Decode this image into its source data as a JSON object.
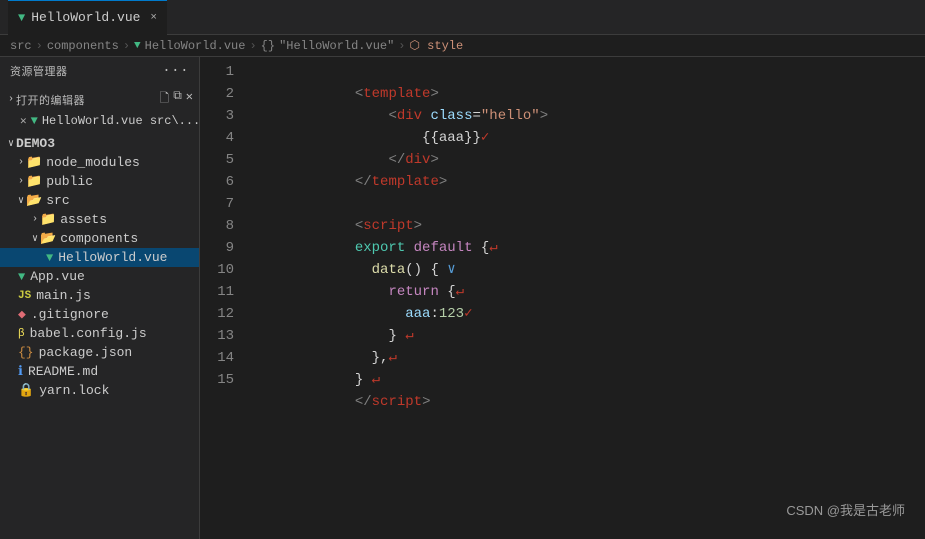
{
  "sidebar": {
    "header": "资源管理器",
    "icons": [
      "···"
    ],
    "open_editors_label": "打开的编辑器",
    "open_file": "HelloWorld.vue src\\...",
    "project_name": "DEMO3",
    "items": [
      {
        "id": "node_modules",
        "label": "node_modules",
        "type": "folder",
        "indent": 1,
        "collapsed": true
      },
      {
        "id": "public",
        "label": "public",
        "type": "folder",
        "indent": 1,
        "collapsed": true
      },
      {
        "id": "src",
        "label": "src",
        "type": "folder",
        "indent": 1,
        "collapsed": false
      },
      {
        "id": "assets",
        "label": "assets",
        "type": "folder",
        "indent": 2,
        "collapsed": true
      },
      {
        "id": "components",
        "label": "components",
        "type": "folder",
        "indent": 2,
        "collapsed": false
      },
      {
        "id": "HelloWorld.vue",
        "label": "HelloWorld.vue",
        "type": "vue",
        "indent": 3,
        "active": true
      },
      {
        "id": "App.vue",
        "label": "App.vue",
        "type": "vue",
        "indent": 1
      },
      {
        "id": "main.js",
        "label": "main.js",
        "type": "js",
        "indent": 1
      },
      {
        "id": ".gitignore",
        "label": ".gitignore",
        "type": "git",
        "indent": 1
      },
      {
        "id": "babel.config.js",
        "label": "babel.config.js",
        "type": "babel",
        "indent": 1
      },
      {
        "id": "package.json",
        "label": "package.json",
        "type": "json",
        "indent": 1
      },
      {
        "id": "README.md",
        "label": "README.md",
        "type": "md",
        "indent": 1
      },
      {
        "id": "yarn.lock",
        "label": "yarn.lock",
        "type": "lock",
        "indent": 1
      }
    ]
  },
  "tab": {
    "filename": "HelloWorld.vue",
    "close_label": "×"
  },
  "breadcrumb": {
    "items": [
      "src",
      ">",
      "components",
      ">",
      "HelloWorld.vue",
      ">",
      "{}",
      "\"HelloWorld.vue\"",
      ">",
      "style"
    ]
  },
  "editor": {
    "lines": [
      {
        "num": 1,
        "content": "template_open"
      },
      {
        "num": 2,
        "content": "div_open"
      },
      {
        "num": 3,
        "content": "interpolation"
      },
      {
        "num": 4,
        "content": "div_close"
      },
      {
        "num": 5,
        "content": "template_close"
      },
      {
        "num": 6,
        "content": "empty"
      },
      {
        "num": 7,
        "content": "script_open"
      },
      {
        "num": 8,
        "content": "export_default"
      },
      {
        "num": 9,
        "content": "data_fn"
      },
      {
        "num": 10,
        "content": "return_open"
      },
      {
        "num": 11,
        "content": "aaa_prop"
      },
      {
        "num": 12,
        "content": "return_close"
      },
      {
        "num": 13,
        "content": "obj_close_comma"
      },
      {
        "num": 14,
        "content": "export_close"
      },
      {
        "num": 15,
        "content": "script_close"
      }
    ]
  },
  "watermark": "CSDN @我是古老师"
}
